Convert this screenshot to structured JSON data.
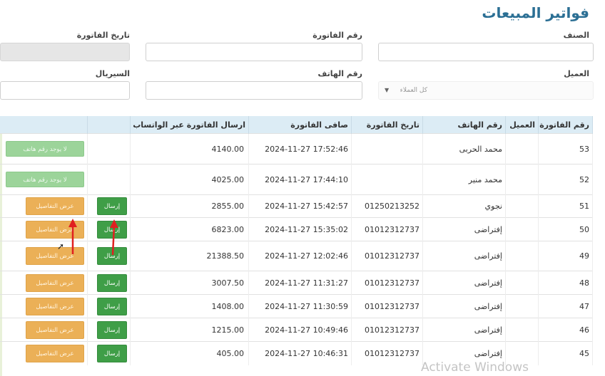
{
  "page": {
    "title": "فواتير المبيعات"
  },
  "filters": {
    "category_label": "الصنف",
    "invoice_number_label": "رقم الفاتورة",
    "invoice_date_label": "تاريخ الفاتورة",
    "customer_label": "العميل",
    "customer_value": "كل العملاء",
    "phone_label": "رقم الهاتف",
    "serial_label": "السيريال"
  },
  "table": {
    "headers": [
      "رقم الفاتورة",
      "العميل",
      "رقم الهاتف",
      "تاريخ الفاتورة",
      "صافى الفاتورة",
      "ارسال الفاتورة عبر الواتساب",
      "",
      ""
    ],
    "rows": [
      {
        "invoice": "53",
        "customer": "",
        "phone_name": "محمد الحربى",
        "phone": "",
        "date": "2024-11-27 17:52:46",
        "net": "4140.00",
        "whatsapp": "",
        "action": "لا يوجد رقم هاتف",
        "type": "nophone"
      },
      {
        "invoice": "52",
        "customer": "",
        "phone_name": "محمد منير",
        "phone": "",
        "date": "2024-11-27 17:44:10",
        "net": "4025.00",
        "whatsapp": "",
        "action": "لا يوجد رقم هاتف",
        "type": "nophone"
      },
      {
        "invoice": "51",
        "customer": "",
        "phone_name": "نجوي",
        "phone": "01250213252",
        "date": "2024-11-27 15:42:57",
        "net": "2855.00",
        "whatsapp": "",
        "send": "إرسال",
        "details": "عرض التفاصيل",
        "type": "send"
      },
      {
        "invoice": "50",
        "customer": "",
        "phone_name": "إفتراضى",
        "phone": "01012312737",
        "date": "2024-11-27 15:35:02",
        "net": "6823.00",
        "whatsapp": "",
        "send": "إرسال",
        "details": "عرض التفاصيل",
        "type": "send"
      },
      {
        "invoice": "49",
        "customer": "",
        "phone_name": "إفتراضى",
        "phone": "01012312737",
        "date": "2024-11-27 12:02:46",
        "net": "21388.50",
        "whatsapp": "",
        "send": "إرسال",
        "details": "عرض التفاصيل",
        "type": "send"
      },
      {
        "invoice": "48",
        "customer": "",
        "phone_name": "إفتراضى",
        "phone": "01012312737",
        "date": "2024-11-27 11:31:27",
        "net": "3007.50",
        "whatsapp": "",
        "send": "إرسال",
        "details": "عرض التفاصيل",
        "type": "send"
      },
      {
        "invoice": "47",
        "customer": "",
        "phone_name": "إفتراضى",
        "phone": "01012312737",
        "date": "2024-11-27 11:30:59",
        "net": "1408.00",
        "whatsapp": "",
        "send": "إرسال",
        "details": "عرض التفاصيل",
        "type": "send"
      },
      {
        "invoice": "46",
        "customer": "",
        "phone_name": "إفتراضى",
        "phone": "01012312737",
        "date": "2024-11-27 10:49:46",
        "net": "1215.00",
        "whatsapp": "",
        "send": "إرسال",
        "details": "عرض التفاصيل",
        "type": "send"
      },
      {
        "invoice": "45",
        "customer": "",
        "phone_name": "إفتراضى",
        "phone": "01012312737",
        "date": "2024-11-27 10:46:31",
        "net": "405.00",
        "whatsapp": "",
        "send": "إرسال",
        "details": "عرض التفاصيل",
        "type": "send"
      }
    ]
  },
  "overlay": {
    "watermark": "Activate Windows",
    "arrow_color": "#e02020"
  }
}
